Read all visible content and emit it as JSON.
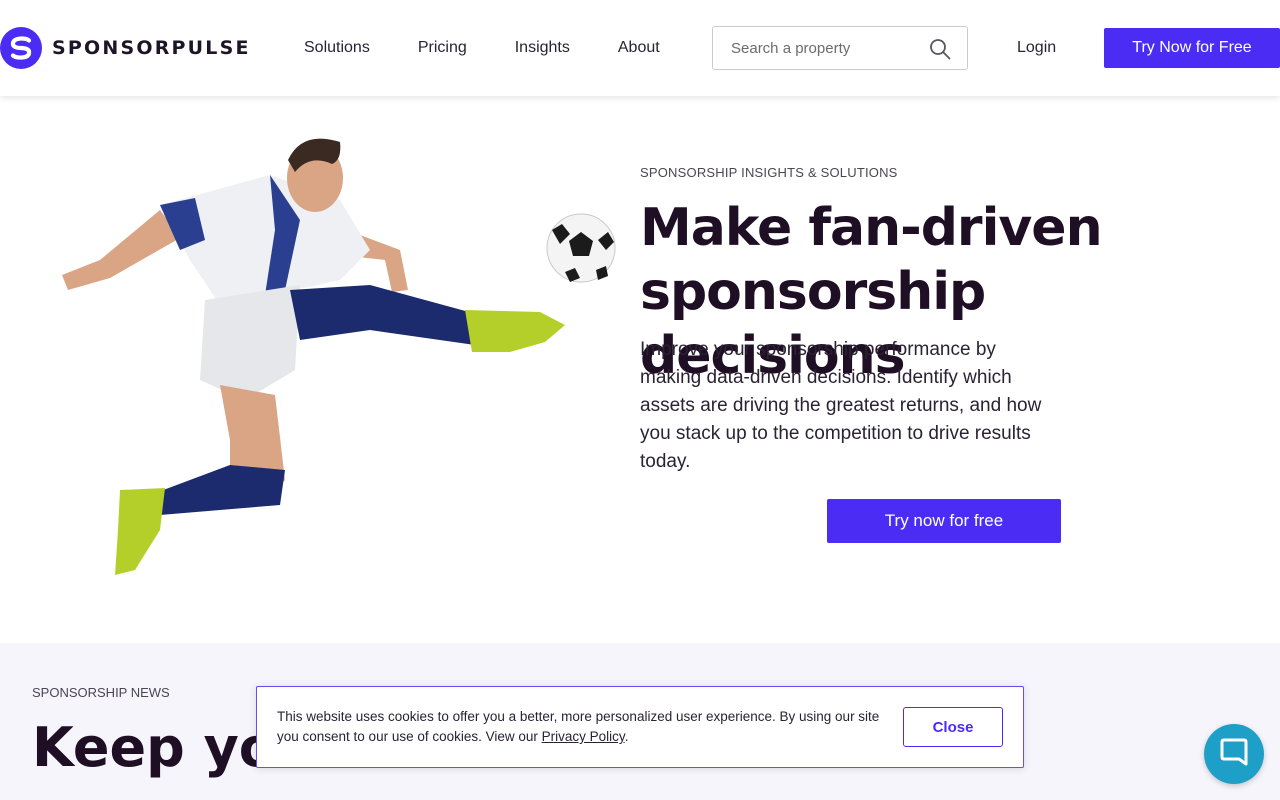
{
  "brand": {
    "name": "SPONSORPULSE",
    "accent": "#4b2cf5"
  },
  "nav": [
    {
      "label": "Solutions"
    },
    {
      "label": "Pricing"
    },
    {
      "label": "Insights"
    },
    {
      "label": "About"
    }
  ],
  "search": {
    "placeholder": "Search a property",
    "icon": "search-icon"
  },
  "header": {
    "login_label": "Login",
    "cta_label": "Try Now for Free"
  },
  "hero": {
    "eyebrow": "SPONSORSHIP INSIGHTS & SOLUTIONS",
    "title": "Make fan-driven sponsorship decisions",
    "description": "Improve your sponsorship performance by making data-driven decisions. Identify which assets are driving the greatest returns, and how you stack up to the competition to drive results today.",
    "cta_label": "Try now for free"
  },
  "news": {
    "eyebrow": "SPONSORSHIP NEWS",
    "title_partial": "Keep you"
  },
  "cookie": {
    "text": "This website uses cookies to offer you a better, more personalized user experience. By using our site you consent to our use of cookies. View our",
    "link_label": "Privacy Policy",
    "close_label": "Close"
  },
  "chat": {
    "icon": "chat-icon",
    "color": "#1e9fc7"
  }
}
